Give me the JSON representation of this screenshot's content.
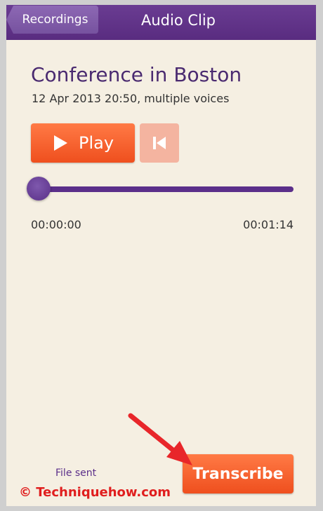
{
  "header": {
    "back_label": "Recordings",
    "title": "Audio Clip"
  },
  "clip": {
    "title": "Conference in Boston",
    "meta": "12 Apr 2013 20:50, multiple voices"
  },
  "player": {
    "play_label": "Play",
    "position_fraction": 0,
    "time_current": "00:00:00",
    "time_total": "00:01:14"
  },
  "footer": {
    "status": "File sent",
    "transcribe_label": "Transcribe"
  },
  "overlay": {
    "watermark": "© Techniquehow.com",
    "arrow_color": "#e8262a"
  },
  "colors": {
    "header_purple": "#5b2f8a",
    "accent_orange": "#f05a28",
    "background": "#f5efe2"
  }
}
